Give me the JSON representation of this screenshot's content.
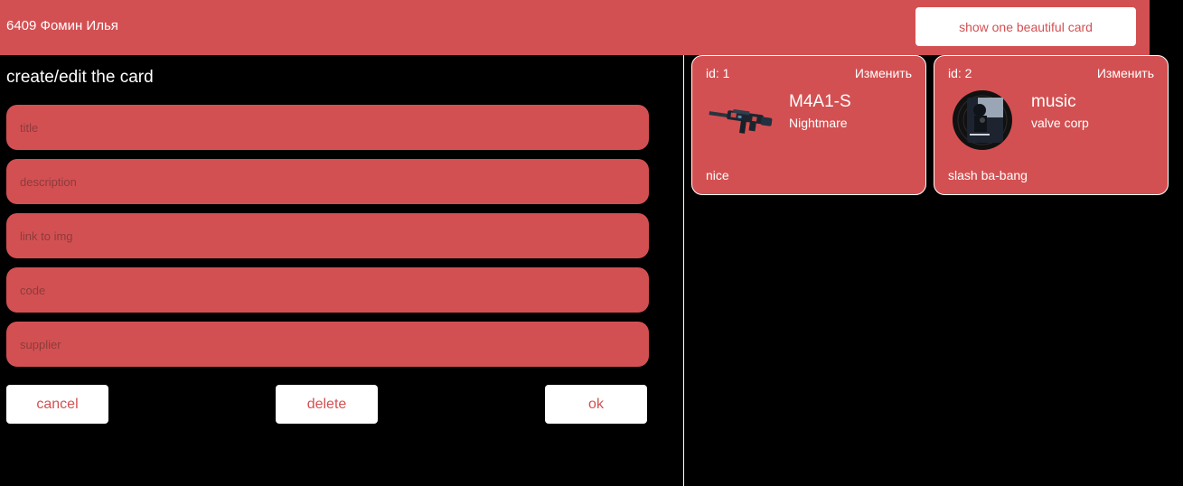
{
  "header": {
    "title": "6409 Фомин Илья",
    "show_button": "show one beautiful card"
  },
  "editor": {
    "title": "create/edit the card",
    "fields": [
      {
        "placeholder": "title",
        "value": ""
      },
      {
        "placeholder": "description",
        "value": ""
      },
      {
        "placeholder": "link to img",
        "value": ""
      },
      {
        "placeholder": "code",
        "value": ""
      },
      {
        "placeholder": "supplier",
        "value": ""
      }
    ],
    "buttons": {
      "cancel": "cancel",
      "delete": "delete",
      "ok": "ok"
    }
  },
  "cards": [
    {
      "id_label": "id: 1",
      "edit_label": "Изменить",
      "title": "M4A1-S",
      "subtitle": "Nightmare",
      "description": "nice",
      "image": "rifle-image"
    },
    {
      "id_label": "id: 2",
      "edit_label": "Изменить",
      "title": "music",
      "subtitle": "valve corp",
      "description": "slash ba-bang",
      "image": "music-disc-image"
    }
  ],
  "colors": {
    "accent": "#d35052",
    "background": "#000000",
    "text": "#ffffff"
  }
}
